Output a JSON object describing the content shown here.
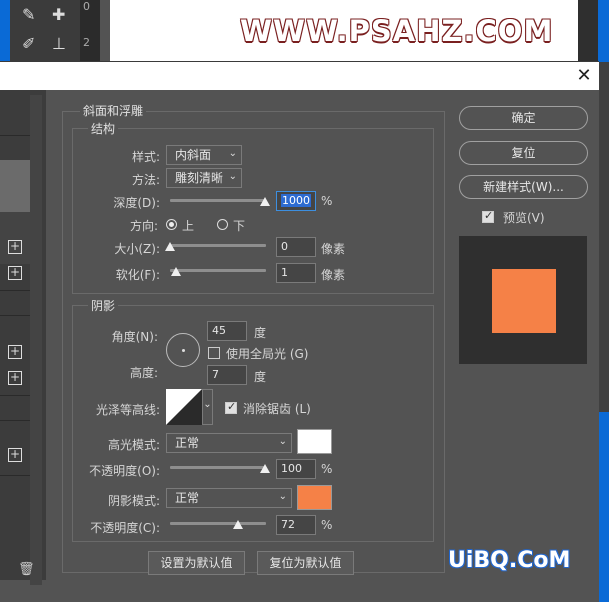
{
  "workspace": {
    "ruler_top": "0",
    "ruler_bottom": "2",
    "watermark_top": "WWW.PSAHZ.COM",
    "watermark_bottom": "UiBQ.CoM"
  },
  "dialog": {
    "close_icon": "close-icon"
  },
  "bevel": {
    "title": "斜面和浮雕",
    "structure": {
      "title": "结构",
      "style_label": "样式:",
      "style_value": "内斜面",
      "method_label": "方法:",
      "method_value": "雕刻清晰",
      "depth_label": "深度(D):",
      "depth_value": "1000",
      "depth_unit": "%",
      "direction_label": "方向:",
      "direction_up": "上",
      "direction_down": "下",
      "direction_selected": "上",
      "size_label": "大小(Z):",
      "size_value": "0",
      "size_unit": "像素",
      "soften_label": "软化(F):",
      "soften_value": "1",
      "soften_unit": "像素"
    },
    "shading": {
      "title": "阴影",
      "angle_label": "角度(N):",
      "angle_value": "45",
      "angle_unit": "度",
      "global_light_label": "使用全局光 (G)",
      "global_light_checked": false,
      "altitude_label": "高度:",
      "altitude_value": "7",
      "altitude_unit": "度",
      "gloss_contour_label": "光泽等高线:",
      "anti_alias_label": "消除锯齿 (L)",
      "anti_alias_checked": true,
      "highlight_mode_label": "高光模式:",
      "highlight_mode_value": "正常",
      "highlight_color": "#ffffff",
      "highlight_opacity_label": "不透明度(O):",
      "highlight_opacity_value": "100",
      "highlight_opacity_unit": "%",
      "shadow_mode_label": "阴影模式:",
      "shadow_mode_value": "正常",
      "shadow_color": "#f58147",
      "shadow_opacity_label": "不透明度(C):",
      "shadow_opacity_value": "72",
      "shadow_opacity_unit": "%"
    },
    "set_default_label": "设置为默认值",
    "reset_default_label": "复位为默认值"
  },
  "actions": {
    "ok_label": "确定",
    "reset_label": "复位",
    "new_style_label": "新建样式(W)...",
    "preview_label": "预览(V)",
    "preview_checked": true,
    "preview_swatch_color": "#f58147"
  }
}
